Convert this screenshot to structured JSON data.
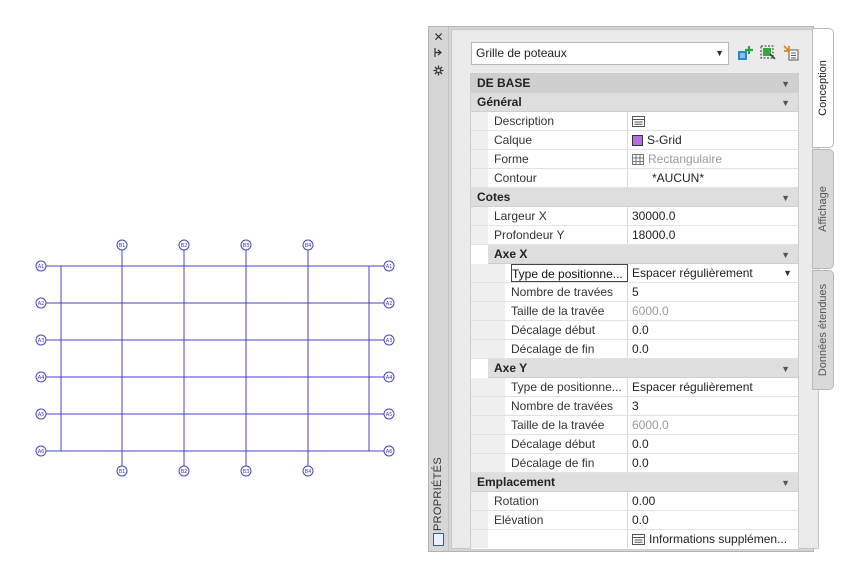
{
  "drawing": {
    "top_labels": [
      "B1",
      "B2",
      "B3",
      "B4"
    ],
    "bottom_labels": [
      "B1",
      "B2",
      "B3",
      "B4"
    ],
    "left_labels": [
      "A1",
      "A2",
      "A3",
      "A4",
      "A5",
      "A6"
    ],
    "right_labels": [
      "A1",
      "A2",
      "A3",
      "A4",
      "A5",
      "A6"
    ],
    "line_color": "#4545c8"
  },
  "palette": {
    "title": "PROPRIÉTÉS",
    "close_icon": "close-icon",
    "style_select_value": "Grille de poteaux",
    "sections": {
      "base": "DE BASE",
      "general": "Général",
      "cotes": "Cotes",
      "axe_x": "Axe X",
      "axe_y": "Axe Y",
      "emplacement": "Emplacement"
    },
    "general": {
      "description_label": "Description",
      "calque_label": "Calque",
      "calque_value": "S-Grid",
      "forme_label": "Forme",
      "forme_value": "Rectangulaire",
      "contour_label": "Contour",
      "contour_value": "*AUCUN*"
    },
    "cotes": {
      "largeur_label": "Largeur X",
      "largeur_value": "30000.0",
      "profondeur_label": "Profondeur Y",
      "profondeur_value": "18000.0"
    },
    "axe_x": {
      "type_label": "Type de positionne...",
      "type_value": "Espacer régulièrement",
      "nb_label": "Nombre de travées",
      "nb_value": "5",
      "taille_label": "Taille de la travée",
      "taille_value": "6000.0",
      "debut_label": "Décalage début",
      "debut_value": "0.0",
      "fin_label": "Décalage de fin",
      "fin_value": "0.0"
    },
    "axe_y": {
      "type_label": "Type de positionne...",
      "type_value": "Espacer régulièrement",
      "nb_label": "Nombre de travées",
      "nb_value": "3",
      "taille_label": "Taille de la travée",
      "taille_value": "6000.0",
      "debut_label": "Décalage début",
      "debut_value": "0.0",
      "fin_label": "Décalage de fin",
      "fin_value": "0.0"
    },
    "emplacement": {
      "rotation_label": "Rotation",
      "rotation_value": "0.00",
      "elevation_label": "Elévation",
      "elevation_value": "0.0",
      "info_value": "Informations supplémen..."
    },
    "tabs": [
      "Conception",
      "Affichage",
      "Données étendues"
    ]
  }
}
